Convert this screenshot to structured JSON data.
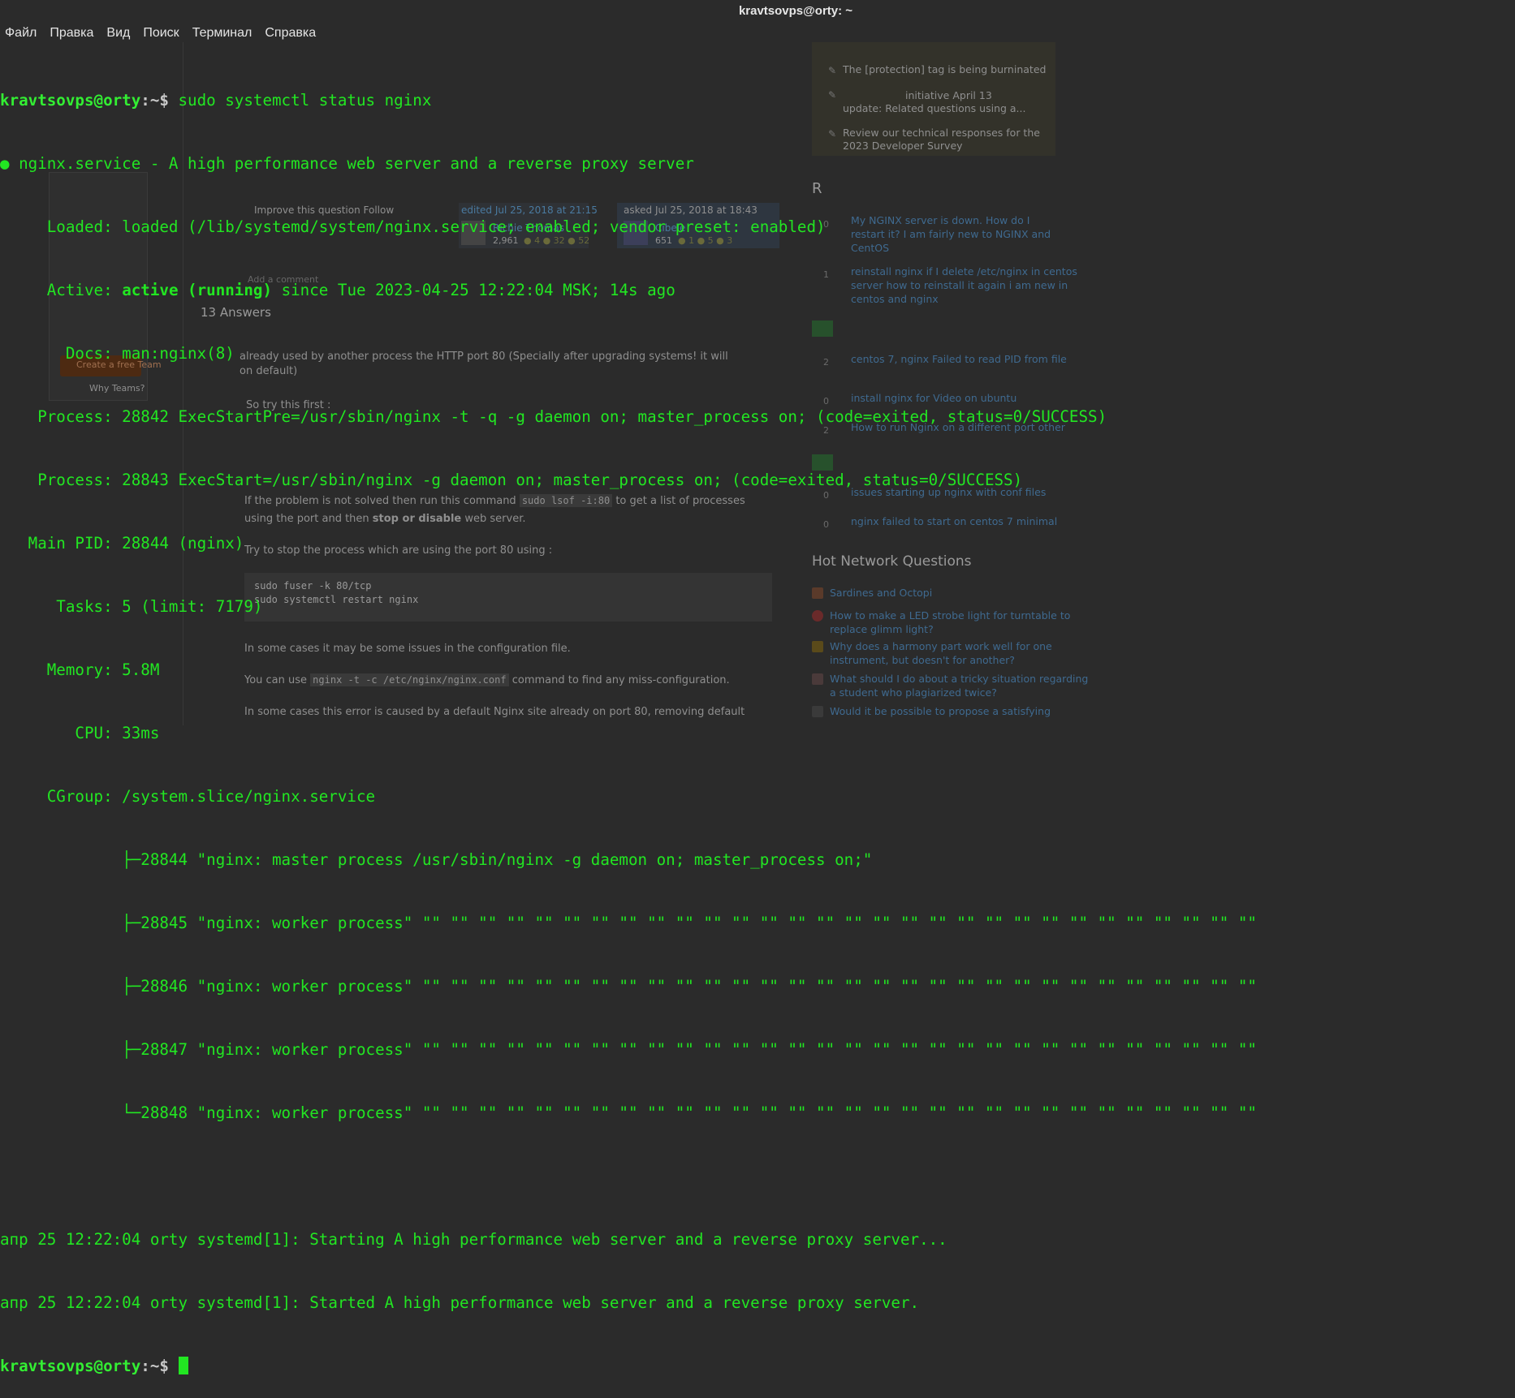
{
  "window": {
    "title": "kravtsovps@orty: ~"
  },
  "menu": [
    "Файл",
    "Правка",
    "Вид",
    "Поиск",
    "Терминал",
    "Справка"
  ],
  "terminal": {
    "prompt_user": "kravtsovps@orty",
    "prompt_path": ":~$",
    "command": " sudo systemctl status nginx",
    "service_line": "● nginx.service - A high performance web server and a reverse proxy server",
    "loaded": "     Loaded: loaded (/lib/systemd/system/nginx.service; enabled; vendor preset: enabled)",
    "active_label": "     Active: ",
    "active_status": "active (running)",
    "active_since": " since Tue 2023-04-25 12:22:04 MSK; 14s ago",
    "docs": "       Docs: man:nginx(8)",
    "process1": "    Process: 28842 ExecStartPre=/usr/sbin/nginx -t -q -g daemon on; master_process on; (code=exited, status=0/SUCCESS)",
    "process2": "    Process: 28843 ExecStart=/usr/sbin/nginx -g daemon on; master_process on; (code=exited, status=0/SUCCESS)",
    "main_pid": "   Main PID: 28844 (nginx)",
    "tasks": "      Tasks: 5 (limit: 7179)",
    "memory": "     Memory: 5.8M",
    "cpu": "        CPU: 33ms",
    "cgroup": "     CGroup: /system.slice/nginx.service",
    "tree": [
      "             ├─28844 \"nginx: master process /usr/sbin/nginx -g daemon on; master_process on;\"",
      "             ├─28845 \"nginx: worker process\" \"\" \"\" \"\" \"\" \"\" \"\" \"\" \"\" \"\" \"\" \"\" \"\" \"\" \"\" \"\" \"\" \"\" \"\" \"\" \"\" \"\" \"\" \"\" \"\" \"\" \"\" \"\" \"\" \"\" \"\"",
      "             ├─28846 \"nginx: worker process\" \"\" \"\" \"\" \"\" \"\" \"\" \"\" \"\" \"\" \"\" \"\" \"\" \"\" \"\" \"\" \"\" \"\" \"\" \"\" \"\" \"\" \"\" \"\" \"\" \"\" \"\" \"\" \"\" \"\" \"\"",
      "             ├─28847 \"nginx: worker process\" \"\" \"\" \"\" \"\" \"\" \"\" \"\" \"\" \"\" \"\" \"\" \"\" \"\" \"\" \"\" \"\" \"\" \"\" \"\" \"\" \"\" \"\" \"\" \"\" \"\" \"\" \"\" \"\" \"\" \"\"",
      "             └─28848 \"nginx: worker process\" \"\" \"\" \"\" \"\" \"\" \"\" \"\" \"\" \"\" \"\" \"\" \"\" \"\" \"\" \"\" \"\" \"\" \"\" \"\" \"\" \"\" \"\" \"\" \"\" \"\" \"\" \"\" \"\" \"\" \"\""
    ],
    "log1": "апр 25 12:22:04 orty systemd[1]: Starting A high performance web server and a reverse proxy server...",
    "log2": "апр 25 12:22:04 orty systemd[1]: Started A high performance web server and a reverse proxy server."
  },
  "background_page": {
    "sidebar_top_items": [
      "The [protection] tag is being burninated",
      "initiative April 13",
      "update: Related questions using a...",
      "Review our technical responses for the",
      "2023 Developer Survey"
    ],
    "related_heading": "R",
    "related": [
      {
        "score": "0",
        "text": "My NGINX server is down. How do I\nrestart it? I am fairly new to NGINX and\nCentOS"
      },
      {
        "score": "1",
        "text": "reinstall nginx if I delete /etc/nginx in centos\nserver how to reinstall it again i am new in\ncentos and nginx"
      },
      {
        "score": "2",
        "text": "centos 7, nginx Failed to read PID from file"
      },
      {
        "score": "0",
        "text": "install nginx for Video on ubuntu"
      },
      {
        "score": "2",
        "text": "How to run Nginx on a different port other"
      },
      {
        "score": "0",
        "text": "issues starting up nginx with conf files"
      },
      {
        "score": "0",
        "text": "nginx failed to start on centos 7 minimal"
      }
    ],
    "hnq_heading": "Hot Network Questions",
    "hnq": [
      "Sardines and Octopi",
      "How to make a LED strobe light for turntable to\nreplace glimm light?",
      "Why does a harmony part work well for one\ninstrument, but doesn't for another?",
      "What should I do about a tricky situation regarding\na student who plagiarized twice?",
      "Would it be possible to propose a satisfying"
    ],
    "main": {
      "improve": "Improve this question  Follow",
      "edited": "edited Jul 25, 2018 at 21:15",
      "editor": "Richie Thomas",
      "editor_rep": "2,961",
      "editor_badges": "● 4  ● 32  ● 52",
      "asked": "asked Jul 25, 2018 at 18:43",
      "asker": "Cibele",
      "asker_rep": "651",
      "asker_badges": "● 1  ● 5  ● 3",
      "add_comment": "Add a comment",
      "answers_count": "13 Answers",
      "answer_intro_1": "already used by another process the HTTP port 80 (Specially after upgrading systems! it will",
      "answer_intro_2": "on default)",
      "try_first": "So try this first :",
      "prob1_pre": "If the problem is not solved then run this command ",
      "prob1_code": "sudo lsof -i:80",
      "prob1_post": " to get a list of processes",
      "prob2_pre": "using the port and then ",
      "prob2_bold": "stop or disable",
      "prob2_post": " web server.",
      "stop_text": "Try to stop the process which are using the port 80 using :",
      "code_block": "sudo fuser -k 80/tcp\nsudo systemctl restart nginx",
      "config_issue": "In some cases it may be some issues in the configuration file.",
      "use_pre": "You can use ",
      "use_code": "nginx -t -c /etc/nginx/nginx.conf",
      "use_post": " command to find any miss-configuration.",
      "default_site": "In some cases this error is caused by a default Nginx site already on port 80, removing default"
    },
    "left": {
      "create_team": "Create a free Team",
      "why_teams": "Why Teams?"
    }
  }
}
